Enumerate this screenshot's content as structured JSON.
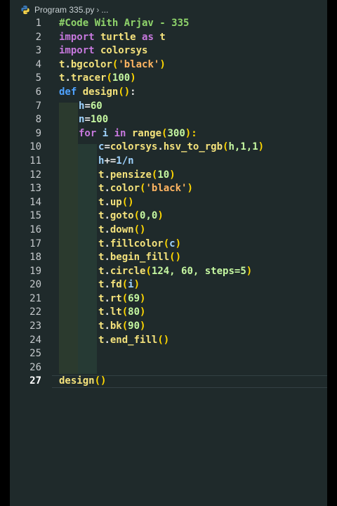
{
  "tab": {
    "filename": "Program 335.py",
    "crumb_rest": "..."
  },
  "code": {
    "line_numbers": [
      "1",
      "2",
      "3",
      "4",
      "5",
      "6",
      "7",
      "8",
      "9",
      "10",
      "11",
      "12",
      "13",
      "14",
      "15",
      "16",
      "17",
      "18",
      "19",
      "20",
      "21",
      "22",
      "23",
      "24",
      "25",
      "26",
      "27"
    ],
    "active_line": "27",
    "l1": "#Code With Arjav - 335",
    "l2": [
      "import",
      " turtle ",
      "as",
      " t"
    ],
    "l3": [
      "import",
      " colorsys"
    ],
    "l4": [
      "t",
      ".",
      "bgcolor",
      "(",
      "'black'",
      ")"
    ],
    "l5": [
      "t",
      ".",
      "tracer",
      "(",
      "100",
      ")"
    ],
    "l6": [
      "def",
      " design",
      "()",
      ":"
    ],
    "l7": [
      "h",
      "=",
      "60"
    ],
    "l8": [
      "n",
      "=",
      "100"
    ],
    "l9": [
      "for",
      " i ",
      "in",
      " range",
      "(",
      "300",
      "):"
    ],
    "l10": [
      "c",
      "=",
      "colorsys",
      ".",
      "hsv_to_rgb",
      "(",
      "h,1,1",
      ")"
    ],
    "l11": [
      "h",
      "+=",
      "1/n"
    ],
    "l12": [
      "t",
      ".",
      "pensize",
      "(",
      "10",
      ")"
    ],
    "l13": [
      "t",
      ".",
      "color",
      "(",
      "'black'",
      ")"
    ],
    "l14": [
      "t",
      ".",
      "up",
      "()"
    ],
    "l15": [
      "t",
      ".",
      "goto",
      "(",
      "0,0",
      ")"
    ],
    "l16": [
      "t",
      ".",
      "down",
      "()"
    ],
    "l17": [
      "t",
      ".",
      "fillcolor",
      "(",
      "c",
      ")"
    ],
    "l18": [
      "t",
      ".",
      "begin_fill",
      "()"
    ],
    "l19": [
      "t",
      ".",
      "circle",
      "(",
      "124, 60, steps=5",
      ")"
    ],
    "l20": [
      "t",
      ".",
      "fd",
      "(",
      "i",
      ")"
    ],
    "l21": [
      "t",
      ".",
      "rt",
      "(",
      "69",
      ")"
    ],
    "l22": [
      "t",
      ".",
      "lt",
      "(",
      "80",
      ")"
    ],
    "l23": [
      "t",
      ".",
      "bk",
      "(",
      "90",
      ")"
    ],
    "l24": [
      "t",
      ".",
      "end_fill",
      "()"
    ],
    "l27": [
      "design",
      "()"
    ]
  },
  "colors": {
    "background": "#1f2a2b",
    "keyword": "#c678dd",
    "def": "#4fa3ff",
    "function": "#f4e27c",
    "string": "#ffb562",
    "number": "#c5f7a1",
    "comment": "#8fd46b"
  },
  "icons": {
    "file": "python-file-icon"
  }
}
